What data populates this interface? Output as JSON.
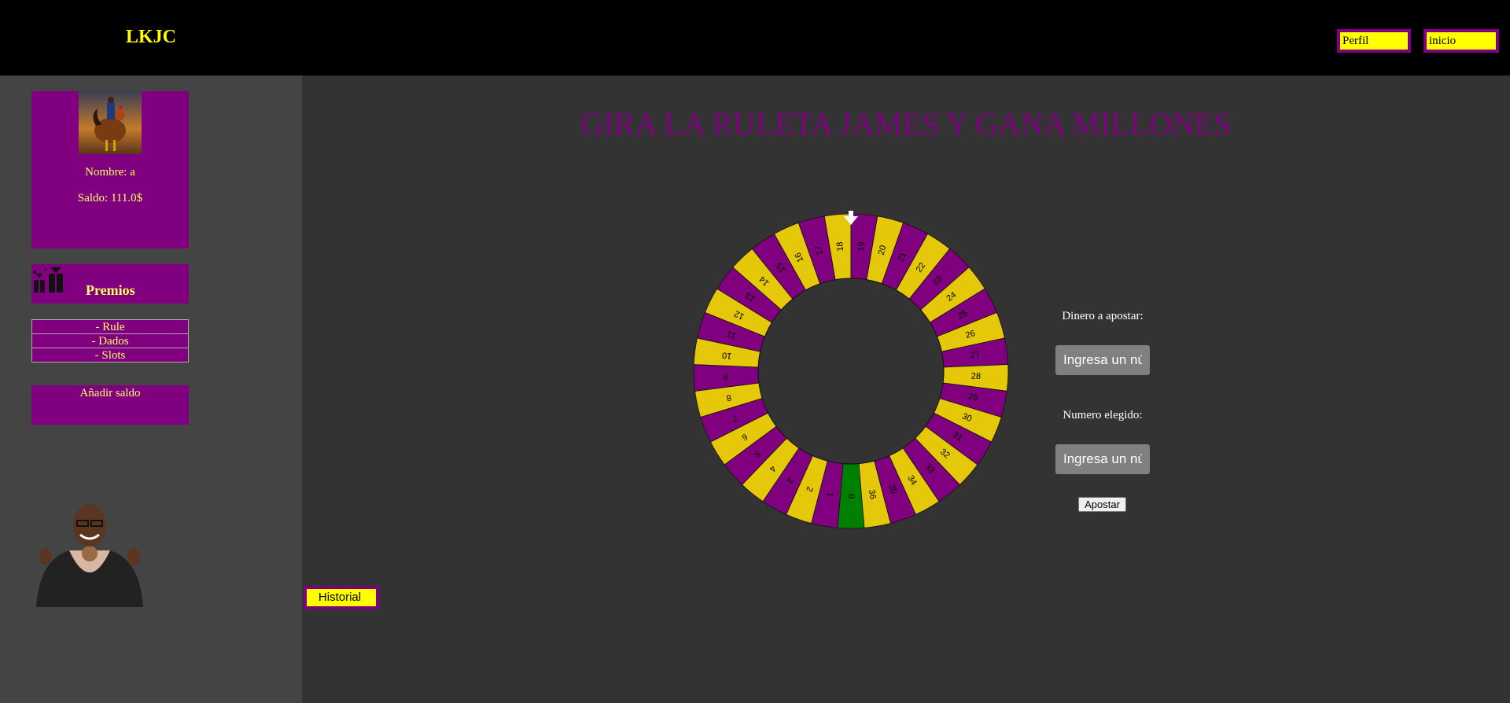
{
  "header": {
    "logo": "LKJC",
    "profile_button": "Perfil",
    "home_button": "inicio"
  },
  "sidebar": {
    "profile": {
      "name_text": "Nombre: a",
      "balance_text": "Saldo: 111.0$"
    },
    "prizes_label": "Premios",
    "games": [
      {
        "label": "- Rule"
      },
      {
        "label": "- Dados"
      },
      {
        "label": "- Slots"
      }
    ],
    "add_balance_label": "Añadir saldo"
  },
  "main": {
    "title": "GIRA LA RULETA JAMES Y GANA MILLONES",
    "history_button": "Historial",
    "wheel": {
      "numbers": [
        0,
        1,
        2,
        3,
        4,
        5,
        6,
        7,
        8,
        9,
        10,
        11,
        12,
        13,
        14,
        15,
        16,
        17,
        18,
        19,
        20,
        21,
        22,
        23,
        24,
        25,
        26,
        27,
        28,
        29,
        30,
        31,
        32,
        33,
        34,
        35,
        36
      ],
      "colors": {
        "even": "#e5c80a",
        "odd": "#800080",
        "zero": "#008000"
      }
    },
    "form": {
      "amount_label": "Dinero a apostar:",
      "amount_placeholder": "Ingresa un número",
      "number_label": "Numero elegido:",
      "number_placeholder": "Ingresa un número",
      "submit_label": "Apostar"
    }
  }
}
